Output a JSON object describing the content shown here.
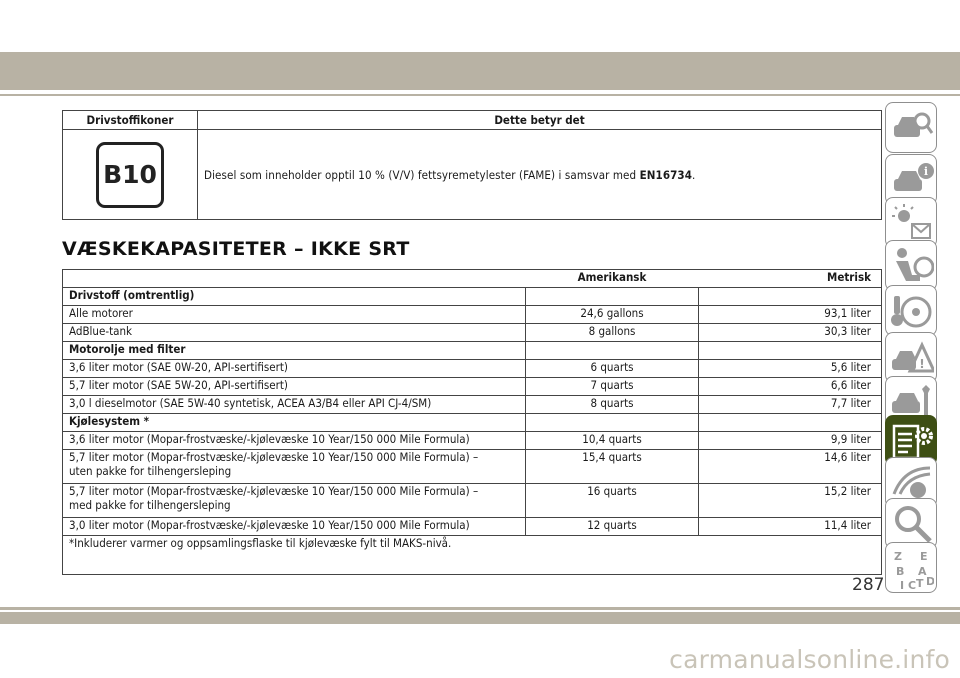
{
  "fuel_table": {
    "header_col1": "Drivstoffikoner",
    "header_col2": "Dette betyr det",
    "icon_label": "B10",
    "description_text": "Diesel som inneholder opptil 10 % (V/V) fettsyremetylester (FAME) i samsvar med ",
    "description_bold": "EN16734",
    "description_end": "."
  },
  "section_title": "VÆSKEKAPASITETER – IKKE SRT",
  "capacity_table": {
    "col_american": "Amerikansk",
    "col_metric": "Metrisk",
    "rows": [
      {
        "type": "section",
        "label": "Drivstoff (omtrentlig)"
      },
      {
        "type": "row",
        "label": "Alle motorer",
        "us": "24,6 gallons",
        "metric": "93,1 liter"
      },
      {
        "type": "row",
        "label": "AdBlue-tank",
        "us": "8 gallons",
        "metric": "30,3 liter"
      },
      {
        "type": "section",
        "label": "Motorolje med filter"
      },
      {
        "type": "row",
        "label": "3,6 liter motor (SAE 0W-20, API-sertifisert)",
        "us": "6 quarts",
        "metric": "5,6 liter"
      },
      {
        "type": "row",
        "label": "5,7 liter motor (SAE 5W-20, API-sertifisert)",
        "us": "7 quarts",
        "metric": "6,6 liter"
      },
      {
        "type": "row",
        "label": "3,0 l dieselmotor (SAE 5W-40 syntetisk, ACEA A3/B4 eller API CJ-4/SM)",
        "us": "8 quarts",
        "metric": "7,7 liter"
      },
      {
        "type": "section",
        "label": "Kjølesystem *"
      },
      {
        "type": "row",
        "label": "3,6 liter motor (Mopar-frostvæske/-kjølevæske 10 Year/150 000 Mile Formula)",
        "us": "10,4 quarts",
        "metric": "9,9 liter"
      },
      {
        "type": "row2",
        "label": "5,7 liter motor (Mopar-frostvæske/-kjølevæske 10 Year/150 000 Mile Formula) –",
        "label2": "uten pakke for tilhengersleping",
        "us": "15,4 quarts",
        "metric": "14,6 liter"
      },
      {
        "type": "row2",
        "label": "5,7 liter motor (Mopar-frostvæske/-kjølevæske 10 Year/150 000 Mile Formula) –",
        "label2": "med pakke for tilhengersleping",
        "us": "16 quarts",
        "metric": "15,2 liter"
      },
      {
        "type": "row",
        "label": "3,0 liter motor (Mopar-frostvæske/-kjølevæske 10 Year/150 000 Mile Formula)",
        "us": "12 quarts",
        "metric": "11,4 liter"
      }
    ],
    "footnote": "*Inkluderer varmer og oppsamlingsflaske til kjølevæske fylt til MAKS-nivå."
  },
  "side_tabs": [
    {
      "icon": "car-search-icon"
    },
    {
      "icon": "car-info-icon"
    },
    {
      "icon": "warning-lights-message-icon"
    },
    {
      "icon": "seat-safety-icon"
    },
    {
      "icon": "steering-key-icon"
    },
    {
      "icon": "roadside-warning-icon"
    },
    {
      "icon": "car-service-icon"
    },
    {
      "icon": "specifications-gear-icon",
      "active": true
    },
    {
      "icon": "multimedia-icon"
    },
    {
      "icon": "search-index-icon"
    },
    {
      "icon": "alphabet-index-icon"
    }
  ],
  "page_number": "287",
  "watermark": "carmanualsonline.info",
  "colors": {
    "band": "#b8b2a4",
    "active_tab": "#3e4f14"
  }
}
